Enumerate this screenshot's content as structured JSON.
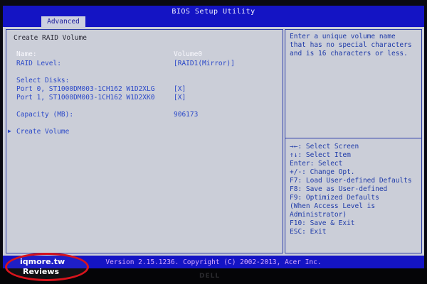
{
  "header": {
    "title": "BIOS Setup Utility",
    "tab": "Advanced"
  },
  "main": {
    "heading": "Create RAID Volume",
    "fields": [
      {
        "label": "Name:",
        "value": "Volume0"
      },
      {
        "label": "RAID Level:",
        "value": "[RAID1(Mirror)]"
      }
    ],
    "disks_heading": "Select Disks:",
    "disks": [
      {
        "label": "Port 0, ST1000DM003-1CH162 W1D2XLG",
        "value": "[X]"
      },
      {
        "label": "Port 1, ST1000DM003-1CH162 W1D2XK0",
        "value": "[X]"
      }
    ],
    "capacity": {
      "label": "Capacity (MB):",
      "value": "906173"
    },
    "action": {
      "marker": "▶",
      "label": "Create Volume"
    }
  },
  "help": {
    "description": [
      "Enter a unique volume name",
      "that has no special characters",
      "and is 16 characters or less."
    ],
    "keys": [
      "→←: Select Screen",
      "↑↓: Select Item",
      "Enter: Select",
      "+/-: Change Opt.",
      "F7: Load User-defined Defaults",
      "F8: Save as User-defined",
      "F9: Optimized Defaults",
      "(When Access Level is",
      "Administrator)",
      "F10: Save & Exit",
      "ESC: Exit"
    ]
  },
  "footer": {
    "version": "Version 2.15.1236. Copyright (C) 2002-2013, Acer Inc."
  },
  "brand": "DELL",
  "watermark": {
    "line1": "iqmore.tw",
    "line2": "Reviews"
  },
  "colors": {
    "header_blue": "#1414c4",
    "panel_gray": "#cbced8",
    "highlight_white": "#fafaff",
    "text_blue": "#2a48c8",
    "watermark_red": "#d8141c"
  }
}
